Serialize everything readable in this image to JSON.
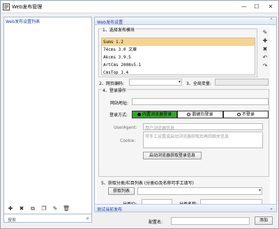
{
  "window": {
    "title": "Web发布管理",
    "minimize": "—",
    "maximize": "☐",
    "close": "✕"
  },
  "left": {
    "title": "Web发布设置列表",
    "search_placeholder": "搜索",
    "toolbar": [
      "✚",
      "✖",
      "⧉",
      "❐",
      "✎",
      "🗑"
    ]
  },
  "right": {
    "header": "Web发布设置",
    "collapse": "⌃",
    "section1_label": "1、选择发布模块",
    "modules": [
      "Sums 1.2",
      "74cms 3.0 文章",
      "Akcms 3.9.5",
      "ArtCms 2008v5.1",
      "CmsTop 1.4"
    ],
    "selected_module": 0,
    "side_icons": [
      "✎",
      "✚",
      "✖",
      "↶",
      "↷"
    ],
    "encoding_label": "2、网页编码:",
    "global_var_label": "3、全局变量:",
    "login_section_label": "4、登录操作",
    "site_url_label": "网站地址:",
    "login_method_label": "登录方式:",
    "login_methods": [
      "内置浏览器登录",
      "数据包登录",
      "不登录"
    ],
    "login_selected": 0,
    "useragent_label": "UserAgent:",
    "useragent_placeholder": "用户浏览器信息",
    "cookie_label": "Cookie:",
    "cookie_placeholder": "可手工设置或启动浏览器获取后再回相关信息",
    "start_browser_button": "启动浏览器获取登录信息",
    "fetch_section_label": "5、获取分类/栏目列表 (分类ID及名称可手工填写)",
    "fetch_list_button": "获取列表",
    "cat_id_label": "分类ID:",
    "cat_name_label": "分类名称:"
  },
  "bottom": {
    "header": "测试当前发布",
    "collapse": "⌄",
    "config_name_label": "配置名:",
    "add_button": "添加"
  }
}
